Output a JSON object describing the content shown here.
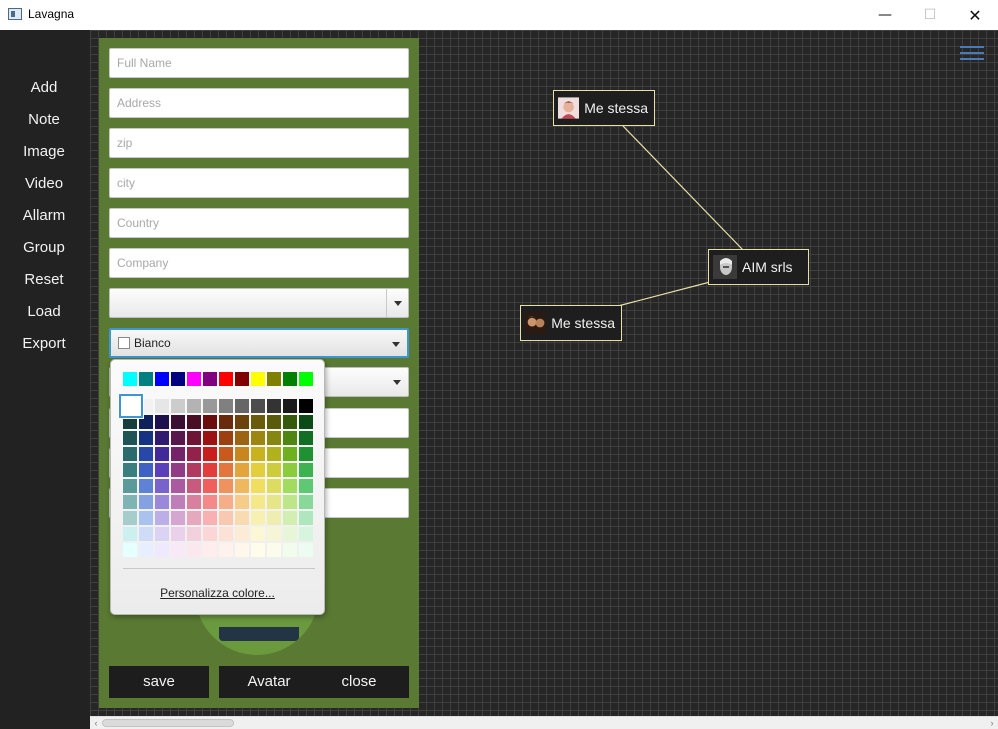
{
  "window": {
    "title": "Lavagna",
    "minimize_glyph": "—",
    "maximize_glyph": "☐",
    "close_glyph": "✕"
  },
  "sidebar": {
    "items": [
      {
        "label": "Add"
      },
      {
        "label": "Note"
      },
      {
        "label": "Image"
      },
      {
        "label": "Video"
      },
      {
        "label": "Allarm"
      },
      {
        "label": "Group"
      },
      {
        "label": "Reset"
      },
      {
        "label": "Load"
      },
      {
        "label": "Export"
      }
    ]
  },
  "form": {
    "fields": [
      {
        "placeholder": "Full Name",
        "value": ""
      },
      {
        "placeholder": "Address",
        "value": ""
      },
      {
        "placeholder": "zip",
        "value": ""
      },
      {
        "placeholder": "city",
        "value": ""
      },
      {
        "placeholder": "Country",
        "value": ""
      },
      {
        "placeholder": "Company",
        "value": ""
      }
    ],
    "type_combo": {
      "value": ""
    },
    "color_combo": {
      "value": "Bianco",
      "swatch": "#ffffff"
    },
    "buttons": {
      "save": "save",
      "avatar": "Avatar",
      "close": "close"
    },
    "panel_color": "#5a7a33"
  },
  "color_picker": {
    "custom_label": "Personalizza colore...",
    "selected": "#ffffff",
    "top_row": [
      "#00ffff",
      "#008080",
      "#0000ff",
      "#000080",
      "#ff00ff",
      "#800080",
      "#ff0000",
      "#800000",
      "#ffff00",
      "#808000",
      "#008000",
      "#00ff00"
    ],
    "gray_row": [
      "#ffffff",
      "#f2f2f2",
      "#e6e6e6",
      "#cccccc",
      "#b3b3b3",
      "#999999",
      "#808080",
      "#666666",
      "#4d4d4d",
      "#333333",
      "#1a1a1a",
      "#000000"
    ],
    "grid": [
      [
        "#183d3d",
        "#10205a",
        "#1e0f4d",
        "#3b0f34",
        "#4a0e24",
        "#6a0c0c",
        "#6a2b0c",
        "#6a430c",
        "#6a5a0c",
        "#5a5a0c",
        "#365a0c",
        "#0c4a18"
      ],
      [
        "#1f5454",
        "#163282",
        "#2f1a70",
        "#57174d",
        "#6e1536",
        "#9c1212",
        "#9c4012",
        "#9c6312",
        "#9c8612",
        "#868612",
        "#4f8612",
        "#126e24"
      ],
      [
        "#2b6b6b",
        "#2748a8",
        "#42299a",
        "#742368",
        "#922249",
        "#c81e1e",
        "#c85a1e",
        "#c8871e",
        "#c8b21e",
        "#b1b11e",
        "#6db11e",
        "#1e9232"
      ],
      [
        "#3a7f7f",
        "#3d62c4",
        "#5b3fba",
        "#913a85",
        "#b23a61",
        "#e33c3c",
        "#e3763c",
        "#e3a43c",
        "#e3cf3c",
        "#cccc3c",
        "#8acc3c",
        "#3cb250"
      ],
      [
        "#5a9a9a",
        "#5e82d6",
        "#7a62cc",
        "#aa5aa0",
        "#c85a7e",
        "#f05e5e",
        "#f0925e",
        "#f0b85e",
        "#f0de5e",
        "#dcdc5e",
        "#a2dc5e",
        "#5ec874"
      ],
      [
        "#7fb4b4",
        "#84a2e2",
        "#9a88da",
        "#c07eb8",
        "#d8809c",
        "#f58888",
        "#f5ae88",
        "#f5cc88",
        "#f5e888",
        "#e6e688",
        "#bce688",
        "#88d89a"
      ],
      [
        "#a6cccc",
        "#aac2ee",
        "#bcaee6",
        "#d4a6d0",
        "#e6a8bc",
        "#f8b0b0",
        "#f8c8b0",
        "#f8dcb0",
        "#f8f0b0",
        "#eeeeb0",
        "#d2eeb0",
        "#b0e6be"
      ],
      [
        "#ccf0f0",
        "#cfdcf8",
        "#dcd2f4",
        "#ead0ea",
        "#f2d0dc",
        "#fcd6d6",
        "#fce2d6",
        "#fcecd6",
        "#fcf8d6",
        "#f6f6d6",
        "#e6f6d6",
        "#d6f4de"
      ],
      [
        "#e6ffff",
        "#e6eeff",
        "#efe8ff",
        "#f8e8f8",
        "#fbe8ef",
        "#ffecec",
        "#fff2ec",
        "#fff6ec",
        "#fffcec",
        "#fcfcec",
        "#f2fcec",
        "#ecfcf0"
      ]
    ]
  },
  "board": {
    "nodes": [
      {
        "label": "Me stessa",
        "avatar": "avatar-photo-icon"
      },
      {
        "label": "AIM srls",
        "avatar": "avatar-photo-icon"
      },
      {
        "label": "Me stessa",
        "avatar": "avatar-photo-icon"
      }
    ],
    "edge_color": "#e8e0a8",
    "menu_icon": "hamburger-menu-icon"
  }
}
